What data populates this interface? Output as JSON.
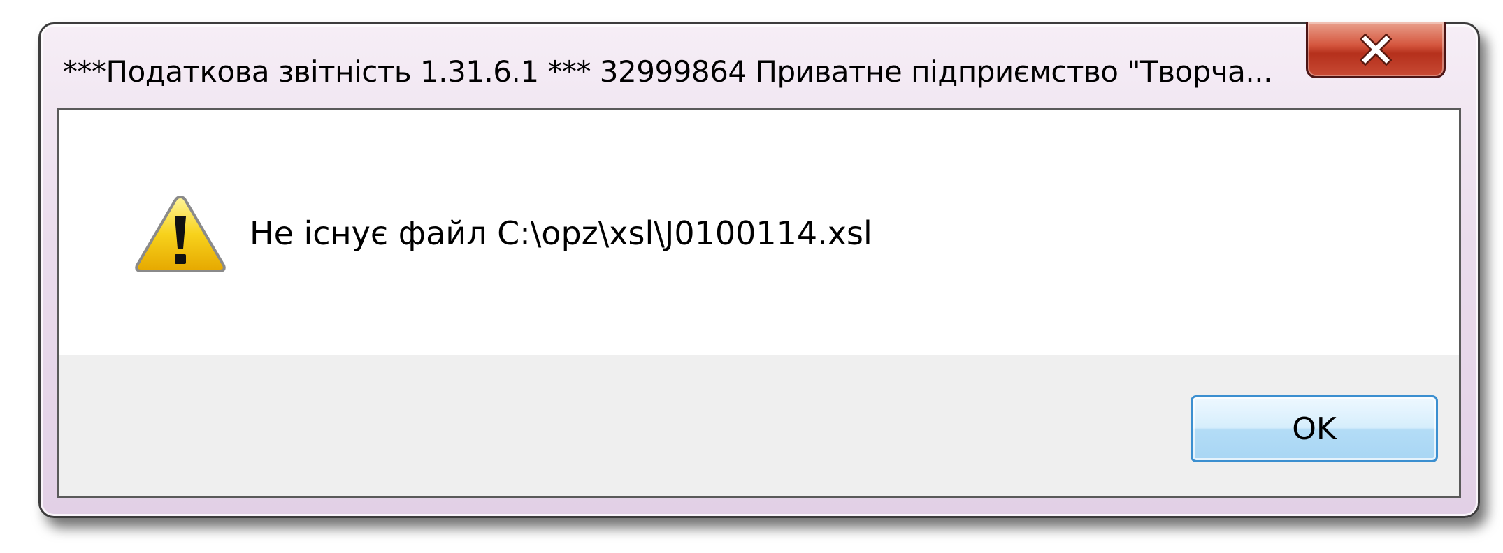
{
  "window": {
    "title": "***Податкова звітність 1.31.6.1 *** 32999864 Приватне підприємство \"Творча..."
  },
  "titlebar": {
    "close_icon": "close-icon"
  },
  "message": {
    "icon": "warning-icon",
    "text": "Не існує файл C:\\opz\\xsl\\J0100114.xsl"
  },
  "buttons": {
    "ok_label": "OK"
  },
  "colors": {
    "close_button": "#c84a34",
    "ok_border": "#3b8fd0",
    "warning_fill": "#f2c200"
  }
}
